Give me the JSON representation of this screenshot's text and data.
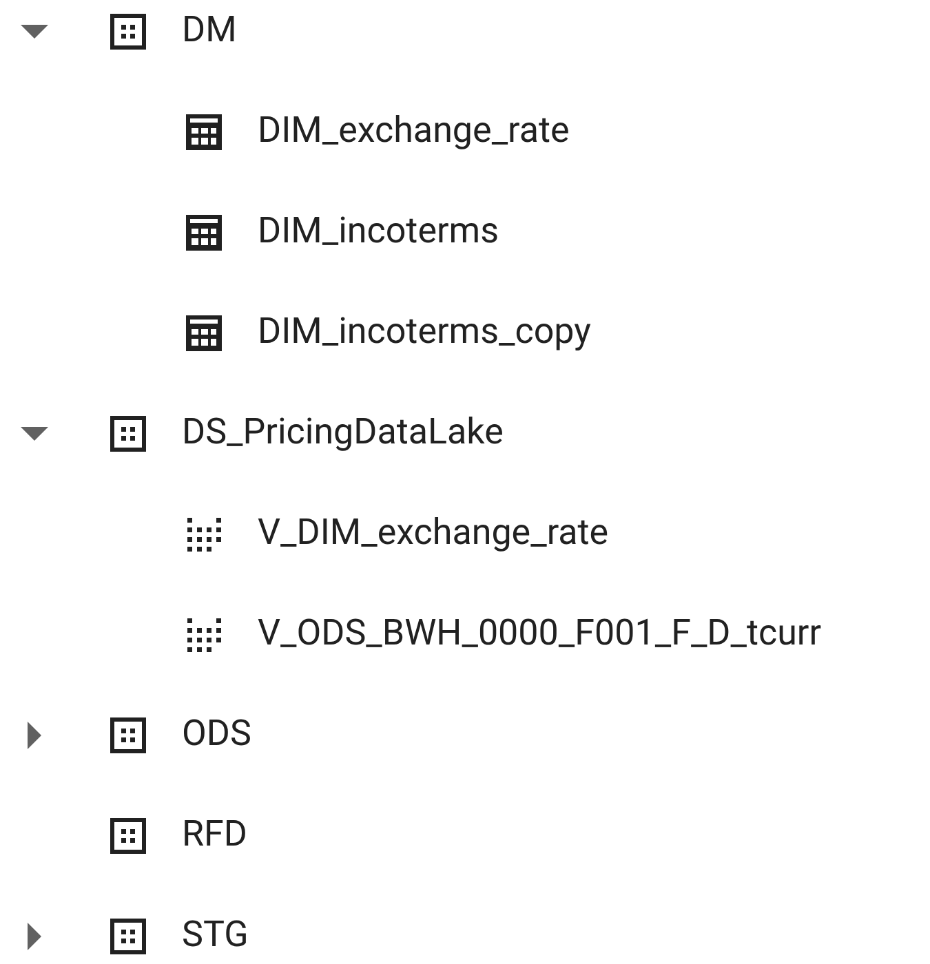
{
  "tree": [
    {
      "kind": "dataset",
      "label": "DM",
      "expanded": true,
      "children": [
        {
          "kind": "table",
          "label": "DIM_exchange_rate"
        },
        {
          "kind": "table",
          "label": "DIM_incoterms"
        },
        {
          "kind": "table",
          "label": "DIM_incoterms_copy"
        }
      ]
    },
    {
      "kind": "dataset",
      "label": "DS_PricingDataLake",
      "expanded": true,
      "children": [
        {
          "kind": "view",
          "label": "V_DIM_exchange_rate"
        },
        {
          "kind": "view",
          "label": "V_ODS_BWH_0000_F001_F_D_tcurr"
        }
      ]
    },
    {
      "kind": "dataset",
      "label": "ODS",
      "expanded": false
    },
    {
      "kind": "dataset",
      "label": "RFD"
    },
    {
      "kind": "dataset",
      "label": "STG",
      "expanded": false
    }
  ]
}
